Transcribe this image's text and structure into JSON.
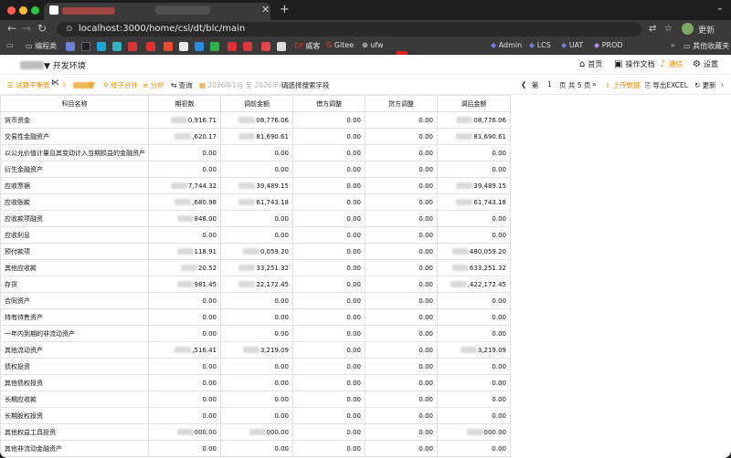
{
  "browser": {
    "url": "localhost:3000/home/csl/dt/blc/main",
    "update_label": "更新",
    "other_bookmarks": "其他收藏夹"
  },
  "bookmarks": [
    {
      "label": "编程类",
      "icon": "folder-icon"
    },
    {
      "label": "威客",
      "icon": "ep-icon"
    },
    {
      "label": "Gitee",
      "icon": "gitee-icon"
    },
    {
      "label": "ufw",
      "icon": "globe-icon"
    },
    {
      "label": "Admin",
      "icon": "admin-icon"
    },
    {
      "label": "LCS",
      "icon": "lcs-icon"
    },
    {
      "label": "UAT",
      "icon": "uat-icon"
    },
    {
      "label": "PROD",
      "icon": "prod-icon"
    }
  ],
  "header": {
    "env_label": "▼ 开发环境",
    "home": "首页",
    "docs": "操作文档",
    "notice": "通信",
    "settings": "设置"
  },
  "toolbar": {
    "trial_balance": "试算平衡表",
    "learn_suffix": "学",
    "parent_child_merge": "母子合并",
    "analysis": "分析",
    "query": "查询",
    "period": "2026年1月 至 2026年4月",
    "choose_field": "请选择搜索字段",
    "page_prefix": "第",
    "page_no": "1",
    "page_total": "页 共 5 页",
    "upload": "上传数据",
    "export": "导出EXCEL",
    "refresh": "更新"
  },
  "table": {
    "columns": [
      "科目名称",
      "期初数",
      "调前金额",
      "借方调整",
      "贷方调整",
      "调后金额"
    ],
    "rows": [
      {
        "name": "货币资金",
        "c1": "0,916.71",
        "c2": "08,776.06",
        "c3": "0.00",
        "c4": "0.00",
        "c5": "08,776.06"
      },
      {
        "name": "交易性金融资产",
        "c1": ",620.17",
        "c2": "81,690.61",
        "c3": "0.00",
        "c4": "0.00",
        "c5": "81,690.61"
      },
      {
        "name": "以公允价值计量且其变动计入当期损益的金融资产",
        "c1": "0.00",
        "c2": "0.00",
        "c3": "0.00",
        "c4": "0.00",
        "c5": "0.00"
      },
      {
        "name": "衍生金融资产",
        "c1": "0.00",
        "c2": "0.00",
        "c3": "0.00",
        "c4": "0.00",
        "c5": "0.00"
      },
      {
        "name": "应收票据",
        "c1": "7,744.32",
        "c2": "39,489.15",
        "c3": "0.00",
        "c4": "0.00",
        "c5": "39,489.15"
      },
      {
        "name": "应收账款",
        "c1": ",680.98",
        "c2": "61,743.18",
        "c3": "0.00",
        "c4": "0.00",
        "c5": "61,743.18"
      },
      {
        "name": "应收款项融资",
        "c1": "848.00",
        "c2": "0.00",
        "c3": "0.00",
        "c4": "0.00",
        "c5": "0.00"
      },
      {
        "name": "应收利息",
        "c1": "0.00",
        "c2": "0.00",
        "c3": "0.00",
        "c4": "0.00",
        "c5": "0.00"
      },
      {
        "name": "预付款项",
        "c1": "118.91",
        "c2": "0,059.20",
        "c3": "0.00",
        "c4": "0.00",
        "c5": "480,059.20"
      },
      {
        "name": "其他应收款",
        "c1": "20.52",
        "c2": "33,251.32",
        "c3": "0.00",
        "c4": "0.00",
        "c5": "633,251.32"
      },
      {
        "name": "存货",
        "c1": "981.45",
        "c2": "22,172.45",
        "c3": "0.00",
        "c4": "0.00",
        "c5": ",422,172.45"
      },
      {
        "name": "合同资产",
        "c1": "0.00",
        "c2": "0.00",
        "c3": "0.00",
        "c4": "0.00",
        "c5": "0.00"
      },
      {
        "name": "持有待售资产",
        "c1": "0.00",
        "c2": "0.00",
        "c3": "0.00",
        "c4": "0.00",
        "c5": "0.00"
      },
      {
        "name": "一年内到期的非流动资产",
        "c1": "0.00",
        "c2": "0.00",
        "c3": "0.00",
        "c4": "0.00",
        "c5": "0.00"
      },
      {
        "name": "其他流动资产",
        "c1": ",516.41",
        "c2": "3,219.09",
        "c3": "0.00",
        "c4": "0.00",
        "c5": "3,219.09"
      },
      {
        "name": "债权投资",
        "c1": "0.00",
        "c2": "0.00",
        "c3": "0.00",
        "c4": "0.00",
        "c5": "0.00"
      },
      {
        "name": "其他债权投资",
        "c1": "0.00",
        "c2": "0.00",
        "c3": "0.00",
        "c4": "0.00",
        "c5": "0.00"
      },
      {
        "name": "长期应收款",
        "c1": "0.00",
        "c2": "0.00",
        "c3": "0.00",
        "c4": "0.00",
        "c5": "0.00"
      },
      {
        "name": "长期股权投资",
        "c1": "0.00",
        "c2": "0.00",
        "c3": "0.00",
        "c4": "0.00",
        "c5": "0.00"
      },
      {
        "name": "其他权益工具投资",
        "c1": "000.00",
        "c2": "000.00",
        "c3": "0.00",
        "c4": "0.00",
        "c5": "000.00"
      },
      {
        "name": "其他非流动金融资产",
        "c1": "0.00",
        "c2": "0.00",
        "c3": "0.00",
        "c4": "0.00",
        "c5": "0.00"
      }
    ]
  }
}
